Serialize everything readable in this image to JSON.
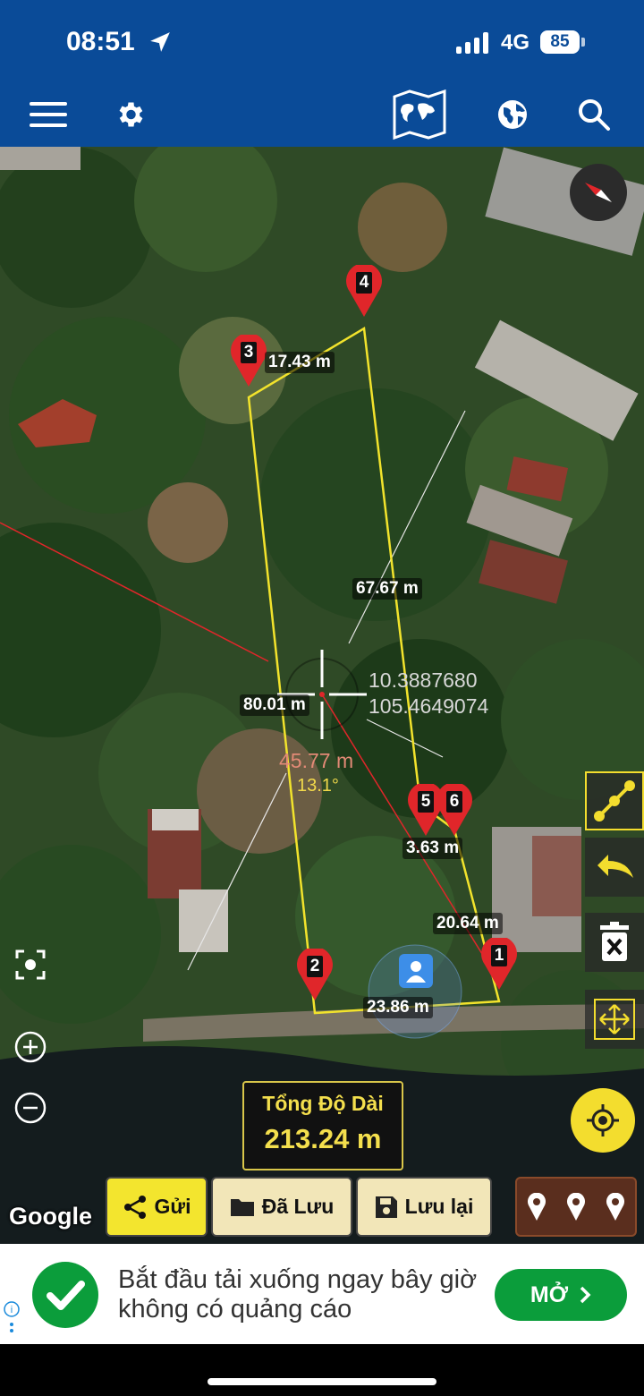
{
  "status_bar": {
    "time": "08:51",
    "network": "4G",
    "battery": "85"
  },
  "toolbar": {
    "icons": [
      "menu-icon",
      "gear-icon",
      "world-map-icon",
      "globe-icon",
      "search-icon"
    ]
  },
  "map": {
    "markers": [
      {
        "id": "1"
      },
      {
        "id": "2"
      },
      {
        "id": "3"
      },
      {
        "id": "4"
      },
      {
        "id": "5"
      },
      {
        "id": "6"
      }
    ],
    "segment_labels": {
      "seg_3_4": "17.43 m",
      "seg_4_5": "67.67 m",
      "seg_2_3": "80.01 m",
      "seg_5_6": "3.63 m",
      "seg_6_1": "20.64 m",
      "seg_1_2": "23.86 m"
    },
    "crosshair": {
      "lat": "10.3887680",
      "lng": "105.4649074"
    },
    "distance_measure": {
      "distance": "45.77 m",
      "angle": "13.1°"
    },
    "total": {
      "label": "Tổng Độ Dài",
      "value": "213.24 m"
    },
    "attribution": "Google",
    "colors": {
      "polygon": "#f2e32c",
      "marker": "#e0262a",
      "accent": "#f3dd2e"
    }
  },
  "bottom_buttons": {
    "send": "Gửi",
    "saved": "Đã Lưu",
    "save": "Lưu lại"
  },
  "ad": {
    "text": "Bắt đầu tải xuống ngay bây giờ không có quảng cáo",
    "button": "MỞ"
  }
}
